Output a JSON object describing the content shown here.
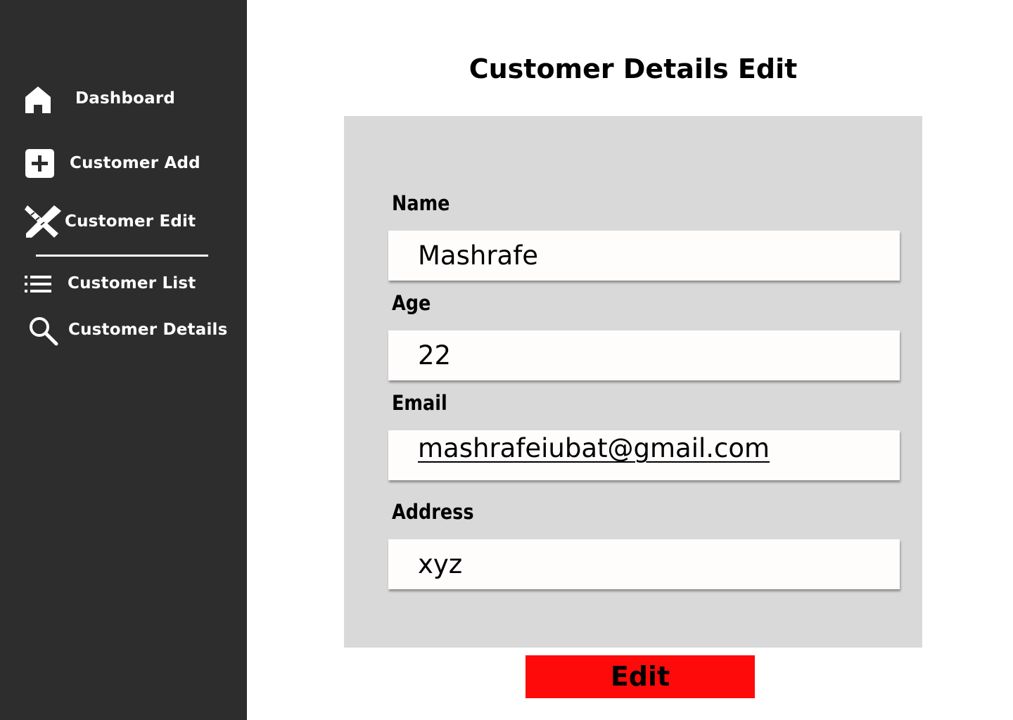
{
  "sidebar": {
    "items": [
      {
        "label": "Dashboard",
        "icon": "home-icon"
      },
      {
        "label": "Customer Add",
        "icon": "plus-square-icon"
      },
      {
        "label": "Customer Edit",
        "icon": "pencil-ruler-icon"
      },
      {
        "label": "Customer List",
        "icon": "list-icon"
      },
      {
        "label": "Customer Details",
        "icon": "search-icon"
      }
    ]
  },
  "main": {
    "title": "Customer Details Edit",
    "fields": {
      "name": {
        "label": "Name",
        "value": "Mashrafe"
      },
      "age": {
        "label": "Age",
        "value": "22"
      },
      "email": {
        "label": "Email",
        "value": "mashrafeiubat@gmail.com"
      },
      "address": {
        "label": "Address",
        "value": "xyz"
      }
    },
    "edit_button_label": "Edit"
  },
  "colors": {
    "sidebar_bg": "#2d2d2d",
    "panel_bg": "#d9d9d9",
    "field_bg": "#fffcfc",
    "button_bg": "#ff0a0a"
  }
}
